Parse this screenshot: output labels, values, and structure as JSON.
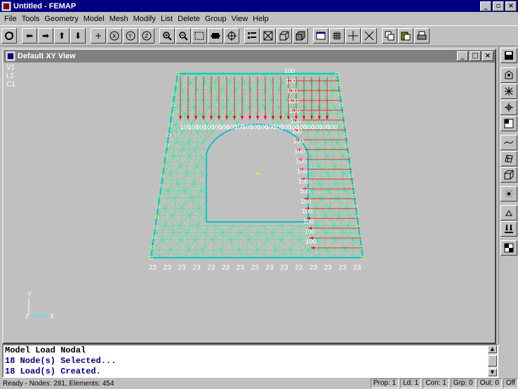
{
  "app": {
    "title": "Untitled - FEMAP"
  },
  "menu": [
    "File",
    "Tools",
    "Geometry",
    "Model",
    "Mesh",
    "Modify",
    "List",
    "Delete",
    "Group",
    "View",
    "Help"
  ],
  "view": {
    "title": "Default XY View",
    "labels": [
      "V1",
      "L1",
      "C1"
    ],
    "load_value": "100",
    "constraint_value": "23",
    "axis_x": "X",
    "axis_y": "Y",
    "colors": {
      "load": "#ff0000",
      "mesh": "#00ff7f",
      "edge": "#00c8c8",
      "label": "#ffffff"
    }
  },
  "messages": [
    "Model Load Nodal",
    "18 Node(s) Selected...",
    "18 Load(s) Created."
  ],
  "status": {
    "main": "Ready - Nodes: 281,  Elements: 454",
    "cells": [
      "Prop: 1",
      "Ld: 1",
      "Con: 1",
      "Grp: 0",
      "Out: 0",
      "Off"
    ]
  }
}
